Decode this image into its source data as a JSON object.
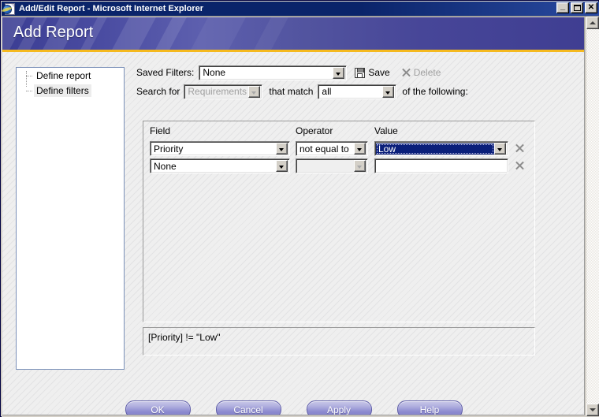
{
  "window": {
    "title": "Add/Edit Report - Microsoft Internet Explorer",
    "icon": "ie-document-icon",
    "minimize_label": "_",
    "maximize_label": "",
    "close_label": "✕"
  },
  "banner": {
    "title": "Add Report",
    "accent_rule_color": "#f5b91e",
    "background_color": "#4b4da2"
  },
  "sidebar": {
    "items": [
      {
        "label": "Define report",
        "selected": false
      },
      {
        "label": "Define filters",
        "selected": true
      }
    ]
  },
  "saved_filters": {
    "label": "Saved Filters:",
    "value": "None",
    "save_label": "Save",
    "save_icon": "floppy-disk-icon",
    "delete_label": "Delete",
    "delete_icon": "x-icon",
    "delete_enabled": false
  },
  "search": {
    "prefix_label": "Search for",
    "entity_value": "Requirements",
    "entity_enabled": false,
    "match_label": "that match",
    "match_value": "all",
    "suffix_label": "of the following:"
  },
  "filter_grid": {
    "columns": [
      "Field",
      "Operator",
      "Value"
    ],
    "rows": [
      {
        "field": "Priority",
        "operator": "not equal to",
        "value": "Low",
        "value_selected": true,
        "operator_enabled": true,
        "value_enabled": true,
        "remove_icon": "x-icon"
      },
      {
        "field": "None",
        "operator": "",
        "value": "",
        "value_selected": false,
        "operator_enabled": false,
        "value_enabled": true,
        "remove_icon": "x-icon"
      }
    ]
  },
  "expression": {
    "text": "[Priority] != \"Low\""
  },
  "buttons": [
    {
      "label": "OK"
    },
    {
      "label": "Cancel"
    },
    {
      "label": "Apply"
    },
    {
      "label": "Help"
    }
  ],
  "scrollbar": {
    "up_icon": "scroll-up-arrow-icon",
    "down_icon": "scroll-down-arrow-icon"
  },
  "colors": {
    "titlebar": "#0a246a",
    "banner": "#4b4da2",
    "accent_rule": "#f5b91e",
    "selection": "#0a1f7a",
    "button": "#8d8bd0",
    "page_bg": "#efefef"
  }
}
